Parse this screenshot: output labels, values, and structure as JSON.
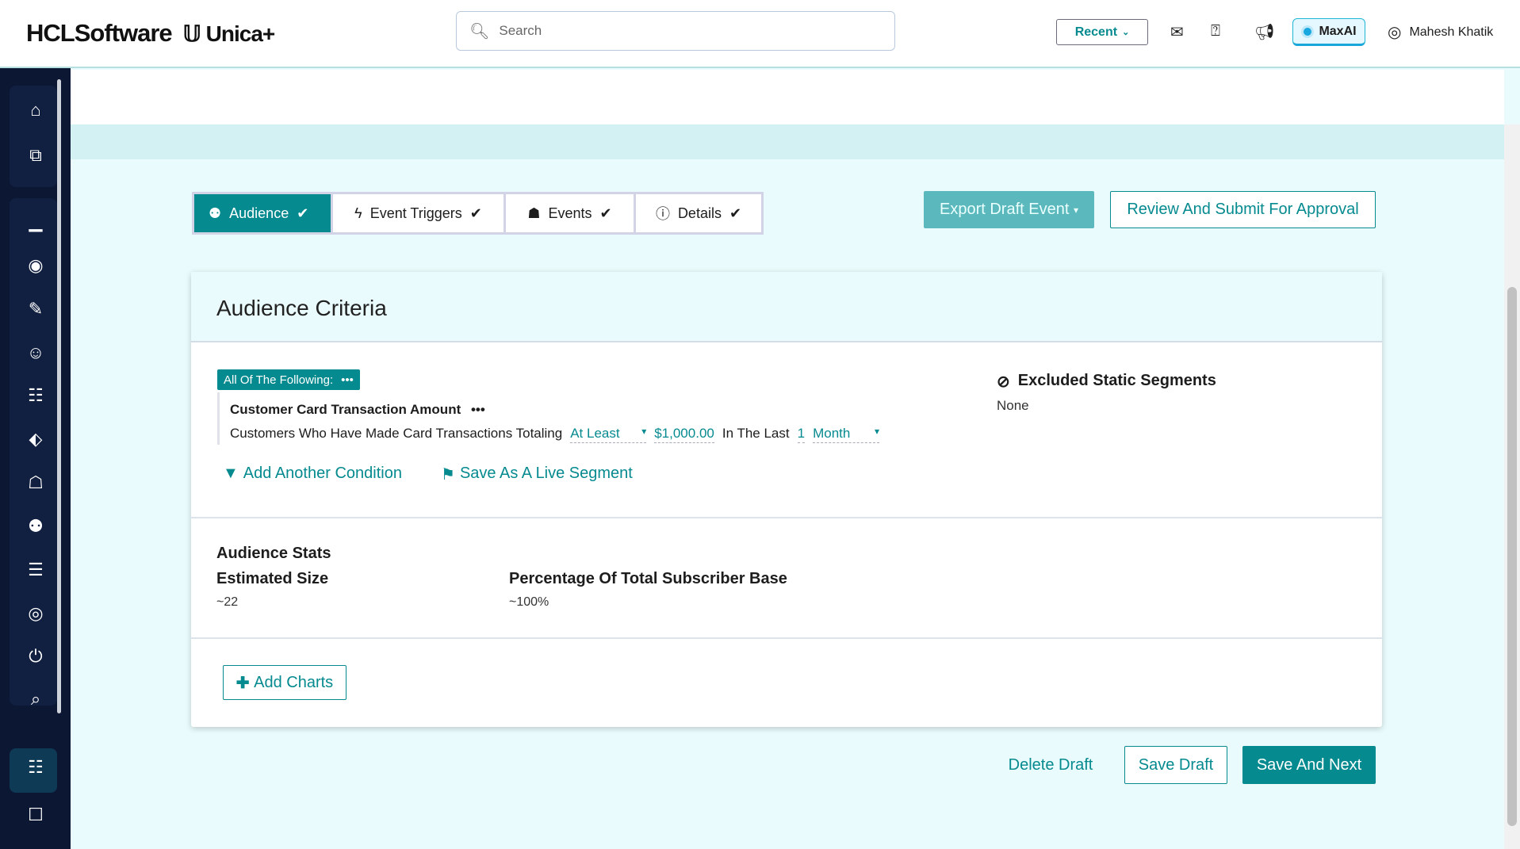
{
  "header": {
    "brand": "HCLSoftware",
    "product": "Unica+",
    "search_placeholder": "Search",
    "recent": "Recent",
    "maxai": "MaxAI",
    "user": "Mahesh Khatik"
  },
  "stepper": [
    {
      "label": "Audience"
    },
    {
      "label": "Event Triggers"
    },
    {
      "label": "Events"
    },
    {
      "label": "Details"
    }
  ],
  "actions": {
    "export": "Export Draft Event",
    "review": "Review And Submit For Approval",
    "delete": "Delete Draft",
    "save_draft": "Save Draft",
    "save_next": "Save And Next"
  },
  "card": {
    "title": "Audience Criteria",
    "group_label": "All Of The Following:",
    "condition_title": "Customer Card Transaction Amount",
    "condition_text": "Customers Who Have Made Card Transactions Totaling",
    "operator": "At Least",
    "amount": "$1,000.00",
    "in_the_last": "In The Last",
    "period_value": "1",
    "period_unit": "Month",
    "add_condition": "Add Another Condition",
    "save_segment": "Save As A Live Segment",
    "excluded_title": "Excluded Static Segments",
    "excluded_value": "None",
    "stats_title": "Audience Stats",
    "est_label": "Estimated Size",
    "est_value": "~22",
    "pct_label": "Percentage Of Total Subscriber Base",
    "pct_value": "~100%",
    "add_charts": "Add Charts"
  },
  "colors": {
    "teal": "#058a8f",
    "sidebar": "#0c1733"
  }
}
